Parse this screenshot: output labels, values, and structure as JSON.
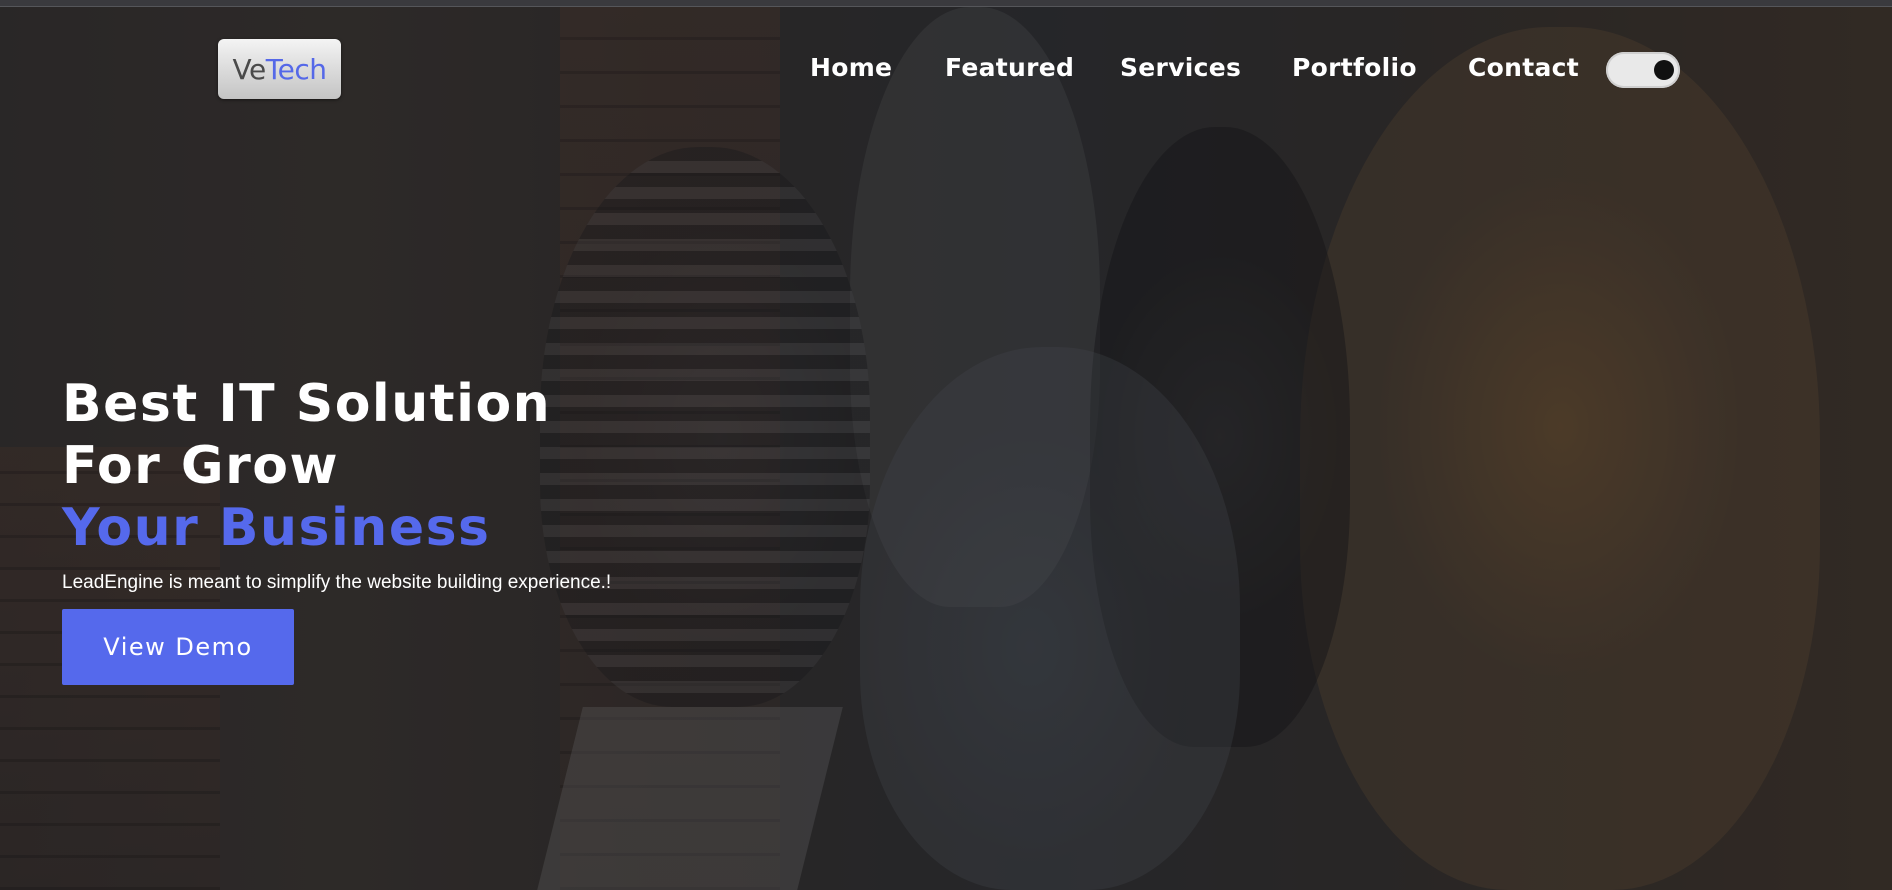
{
  "brand": {
    "logo_part1": "Ve",
    "logo_part2": "Tech"
  },
  "nav": {
    "items": [
      {
        "label": "Home"
      },
      {
        "label": "Featured"
      },
      {
        "label": "Services"
      },
      {
        "label": "Portfolio"
      },
      {
        "label": "Contact"
      }
    ],
    "theme_toggle": {
      "state": "on"
    }
  },
  "hero": {
    "headline_line1": "Best IT Solution",
    "headline_line2": "For Grow",
    "headline_accent": "Your Business",
    "subtitle": "LeadEngine is meant to simplify the website building experience.!",
    "cta_label": "View Demo",
    "background_image": "team-of-coworkers-looking-at-laptop-photo"
  },
  "colors": {
    "accent": "#5569ec",
    "text": "#ffffff",
    "toggle_track": "#e9e9e9",
    "toggle_knob": "#111111"
  }
}
